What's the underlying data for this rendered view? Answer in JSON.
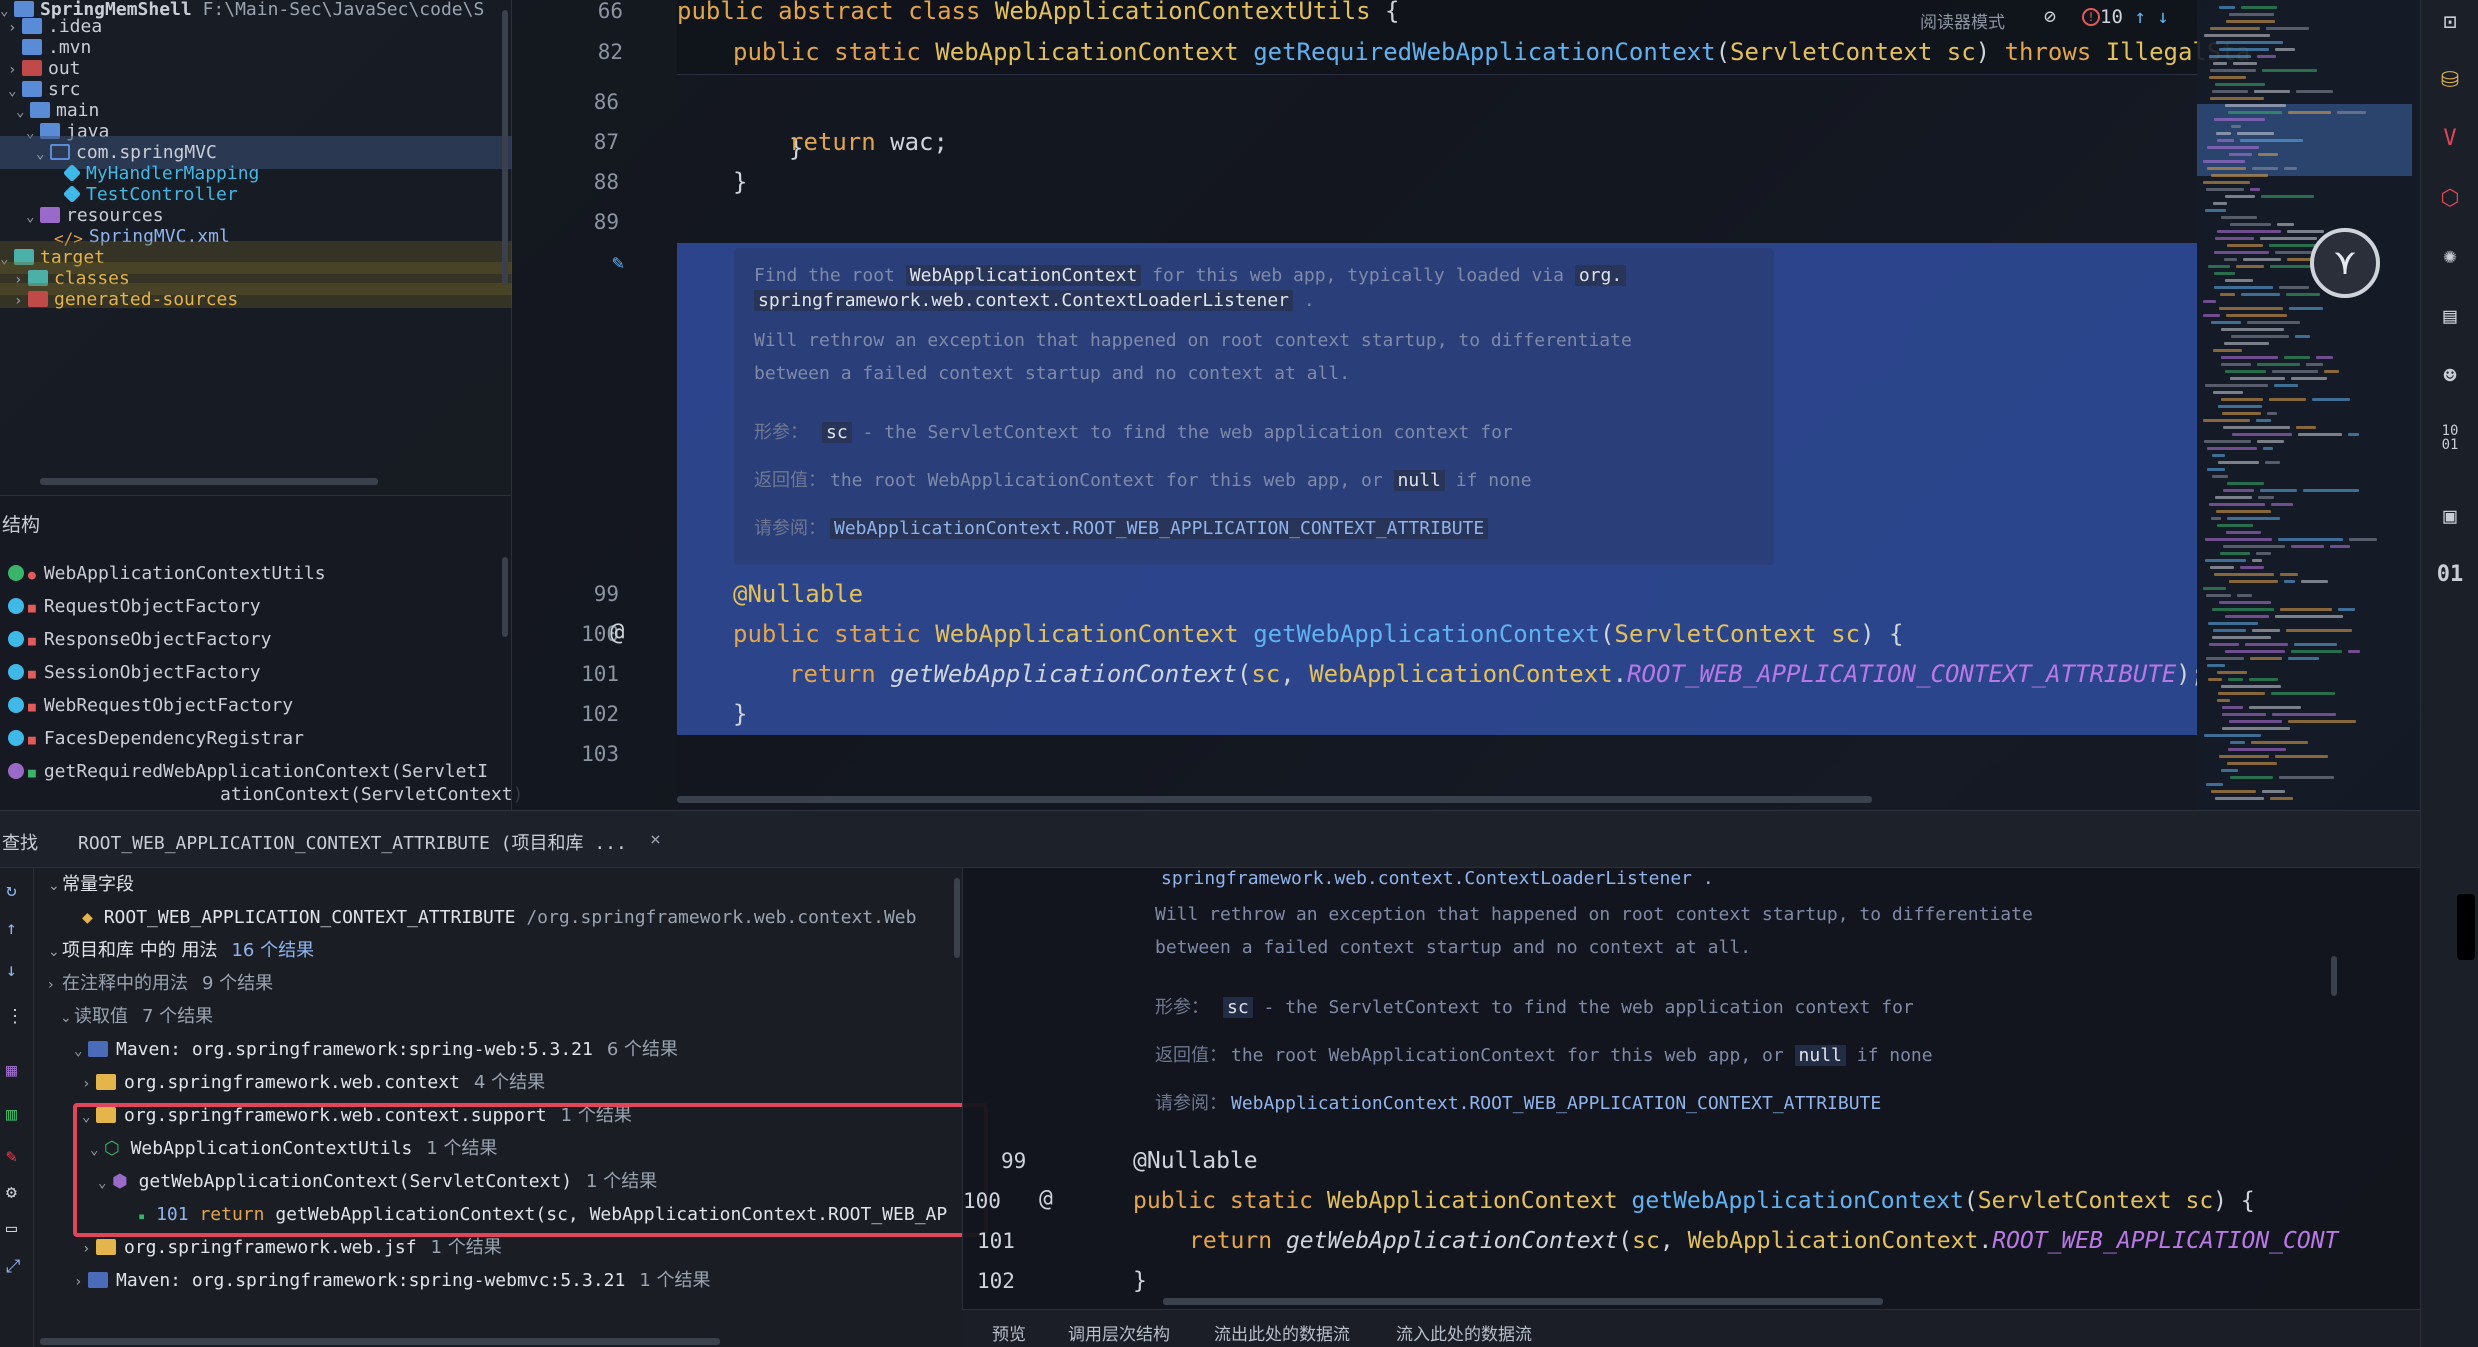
{
  "project": {
    "root_name": "SpringMemShell",
    "root_path": "F:\\Main-Sec\\JavaSec\\code\\S",
    "items": [
      {
        "label": ".idea"
      },
      {
        "label": ".mvn"
      },
      {
        "label": "out"
      },
      {
        "label": "src"
      },
      {
        "label": "main"
      },
      {
        "label": "java"
      },
      {
        "label": "com.springMVC"
      },
      {
        "label": "MyHandlerMapping"
      },
      {
        "label": "TestController"
      },
      {
        "label": "resources"
      },
      {
        "label": "SpringMVC.xml"
      },
      {
        "label": "target"
      },
      {
        "label": "classes"
      },
      {
        "label": "generated-sources"
      }
    ]
  },
  "structure": {
    "title": "结构",
    "items": [
      {
        "label": "WebApplicationContextUtils"
      },
      {
        "label": "RequestObjectFactory"
      },
      {
        "label": "ResponseObjectFactory"
      },
      {
        "label": "SessionObjectFactory"
      },
      {
        "label": "WebRequestObjectFactory"
      },
      {
        "label": "FacesDependencyRegistrar"
      },
      {
        "label": "getRequiredWebApplicationContext(ServletI"
      },
      {
        "label": "ationContext(ServletContext)"
      }
    ]
  },
  "editor": {
    "reader_mode": "阅读器模式",
    "warnings": "10",
    "sticky": [
      {
        "num": "66",
        "code": "public abstract class WebApplicationContextUtils {"
      },
      {
        "num": "82",
        "code": "public static WebApplicationContext getRequiredWebApplicationContext(ServletContext sc) throws IllegalSta"
      }
    ],
    "line_numbers": [
      "86",
      "87",
      "88",
      "89",
      "99",
      "100",
      "101",
      "102",
      "103"
    ],
    "lines": {
      "l86": "}",
      "l87_kw": "return",
      "l87_rest": " wac;",
      "l88": "}",
      "l99": "@Nullable",
      "l100_kw": "public static",
      "l100_type": "WebApplicationContext",
      "l100_fn": "getWebApplicationContext",
      "l100_ptype": "ServletContext",
      "l100_param": "sc",
      "l101_kw": "return",
      "l101_fn": "getWebApplicationContext",
      "l101_arg": "sc",
      "l101_cls": "WebApplicationContext",
      "l101_const": "ROOT_WEB_APPLICATION_CONTEXT_ATTRIBUTE",
      "l102": "}"
    },
    "doc": {
      "d1a": "Find the root",
      "d1b": "WebApplicationContext",
      "d1c": "for this web app, typically loaded via",
      "d1d": "org.",
      "d2": "springframework.web.context.ContextLoaderListener",
      "d3": "Will rethrow an exception that happened on root context startup, to differentiate",
      "d4": "between a failed context startup and no context at all.",
      "param_label": "形参：",
      "param_name": "sc",
      "param_desc": "- the ServletContext to find the web application context for",
      "ret_label": "返回值：",
      "ret_a": "the root WebApplicationContext for this web app, or",
      "ret_null": "null",
      "ret_b": "if none",
      "see_label": "请参阅：",
      "see_link": "WebApplicationContext.ROOT_WEB_APPLICATION_CONTEXT_ATTRIBUTE"
    }
  },
  "find": {
    "tab_label": "查找",
    "query": "ROOT_WEB_APPLICATION_CONTEXT_ATTRIBUTE (项目和库 ...",
    "close": "×",
    "rows": [
      {
        "label": "常量字段",
        "count": ""
      },
      {
        "label": "ROOT_WEB_APPLICATION_CONTEXT_ATTRIBUTE",
        "extra": "/org.springframework.web.context.Web"
      },
      {
        "label": "项目和库 中的 用法",
        "count": "16 个结果"
      },
      {
        "label": "在注释中的用法",
        "count": "9 个结果"
      },
      {
        "label": "读取值",
        "count": "7 个结果"
      },
      {
        "label": "Maven: org.springframework:spring-web:5.3.21",
        "count": "6 个结果"
      },
      {
        "label": "org.springframework.web.context",
        "count": "4 个结果"
      },
      {
        "label": "org.springframework.web.context.support",
        "count": "1 个结果"
      },
      {
        "label": "WebApplicationContextUtils",
        "count": "1 个结果"
      },
      {
        "label": "getWebApplicationContext(ServletContext)",
        "count": "1 个结果"
      },
      {
        "label": "101",
        "code_kw": "return",
        "code": "getWebApplicationContext(sc, WebApplicationContext.ROOT_WEB_AP"
      },
      {
        "label": "org.springframework.web.jsf",
        "count": "1 个结果"
      },
      {
        "label": "Maven: org.springframework:spring-webmvc:5.3.21",
        "count": "1 个结果"
      }
    ]
  },
  "preview": {
    "doc_d2": "springframework.web.context.ContextLoaderListener .",
    "line_numbers": [
      "99",
      "100",
      "101",
      "102"
    ],
    "l99": "@Nullable",
    "l101_const": "ROOT_WEB_APPLICATION_CONT",
    "tabs": [
      "预览",
      "调用层次结构",
      "流出此处的数据流",
      "流入此处的数据流"
    ]
  },
  "colors": {
    "highlight": "#3456b4",
    "red_box": "#e0455a",
    "keyword": "#e3a54a",
    "function": "#60b2f0",
    "constant": "#b978e6"
  }
}
